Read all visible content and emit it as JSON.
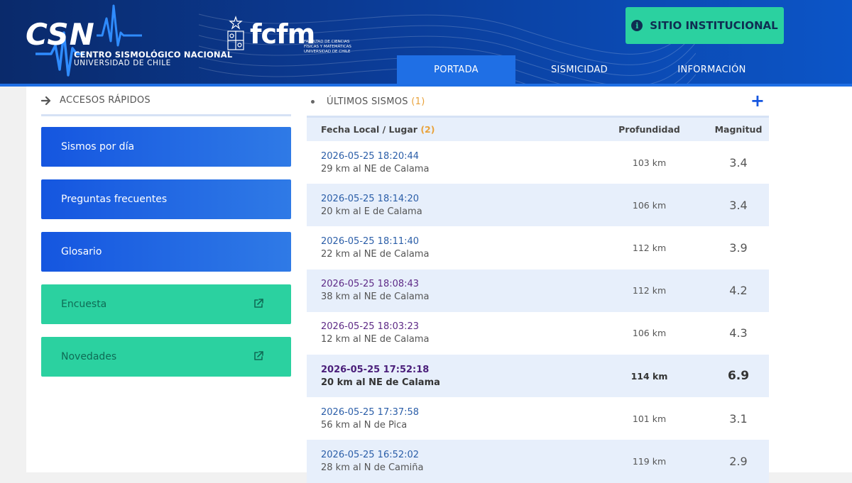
{
  "header": {
    "logo_text": "CSN",
    "logo_name": "CENTRO SISMOLÓGICO NACIONAL",
    "logo_university": "UNIVERSIDAD DE CHILE",
    "fcfm_word": "fcfm",
    "fcfm_sub": "FACULTAD DE CIENCIAS FÍSICAS Y MATEMÁTICAS UNIVERSIDAD DE CHILE",
    "institutional_button": "SITIO INSTITUCIONAL",
    "tabs": [
      {
        "label": "PORTADA",
        "active": true
      },
      {
        "label": "SISMICIDAD",
        "active": false
      },
      {
        "label": "INFORMACIÓN",
        "active": false
      }
    ]
  },
  "sidebar": {
    "title": "ACCESOS RÁPIDOS",
    "items": [
      {
        "label": "Sismos por día",
        "style": "blue"
      },
      {
        "label": "Preguntas frecuentes",
        "style": "blue"
      },
      {
        "label": "Glosario",
        "style": "blue"
      },
      {
        "label": "Encuesta",
        "style": "green",
        "external": true
      },
      {
        "label": "Novedades",
        "style": "green",
        "external": true
      }
    ]
  },
  "feed": {
    "title": "ÚLTIMOS SISMOS",
    "title_count": "(1)",
    "columns": {
      "place": "Fecha Local / Lugar",
      "place_count": "(2)",
      "depth": "Profundidad",
      "magnitude": "Magnitud"
    },
    "rows": [
      {
        "date": "2026-05-25 18:20:44",
        "place": "29 km al NE de Calama",
        "depth": "103 km",
        "magnitude": "3.4"
      },
      {
        "date": "2026-05-25 18:14:20",
        "place": "20 km al E de Calama",
        "depth": "106 km",
        "magnitude": "3.4"
      },
      {
        "date": "2026-05-25 18:11:40",
        "place": "22 km al NE de Calama",
        "depth": "112 km",
        "magnitude": "3.9"
      },
      {
        "date": "2026-05-25 18:08:43",
        "place": "38 km al NE de Calama",
        "depth": "112 km",
        "magnitude": "4.2"
      },
      {
        "date": "2026-05-25 18:03:23",
        "place": "12 km al NE de Calama",
        "depth": "106 km",
        "magnitude": "4.3"
      },
      {
        "date": "2026-05-25 17:52:18",
        "place": "20 km al NE de Calama",
        "depth": "114 km",
        "magnitude": "6.9"
      },
      {
        "date": "2026-05-25 17:37:58",
        "place": "56 km al N de Pica",
        "depth": "101 km",
        "magnitude": "3.1"
      },
      {
        "date": "2026-05-25 16:52:02",
        "place": "28 km al N de Camiña",
        "depth": "119 km",
        "magnitude": "2.9"
      }
    ]
  },
  "colors": {
    "header_dark": "#0a2a6b",
    "header_light": "#0c55c7",
    "accent_green": "#2bd1a0",
    "accent_blue": "#1556e0",
    "row_alt": "#e7effb"
  }
}
